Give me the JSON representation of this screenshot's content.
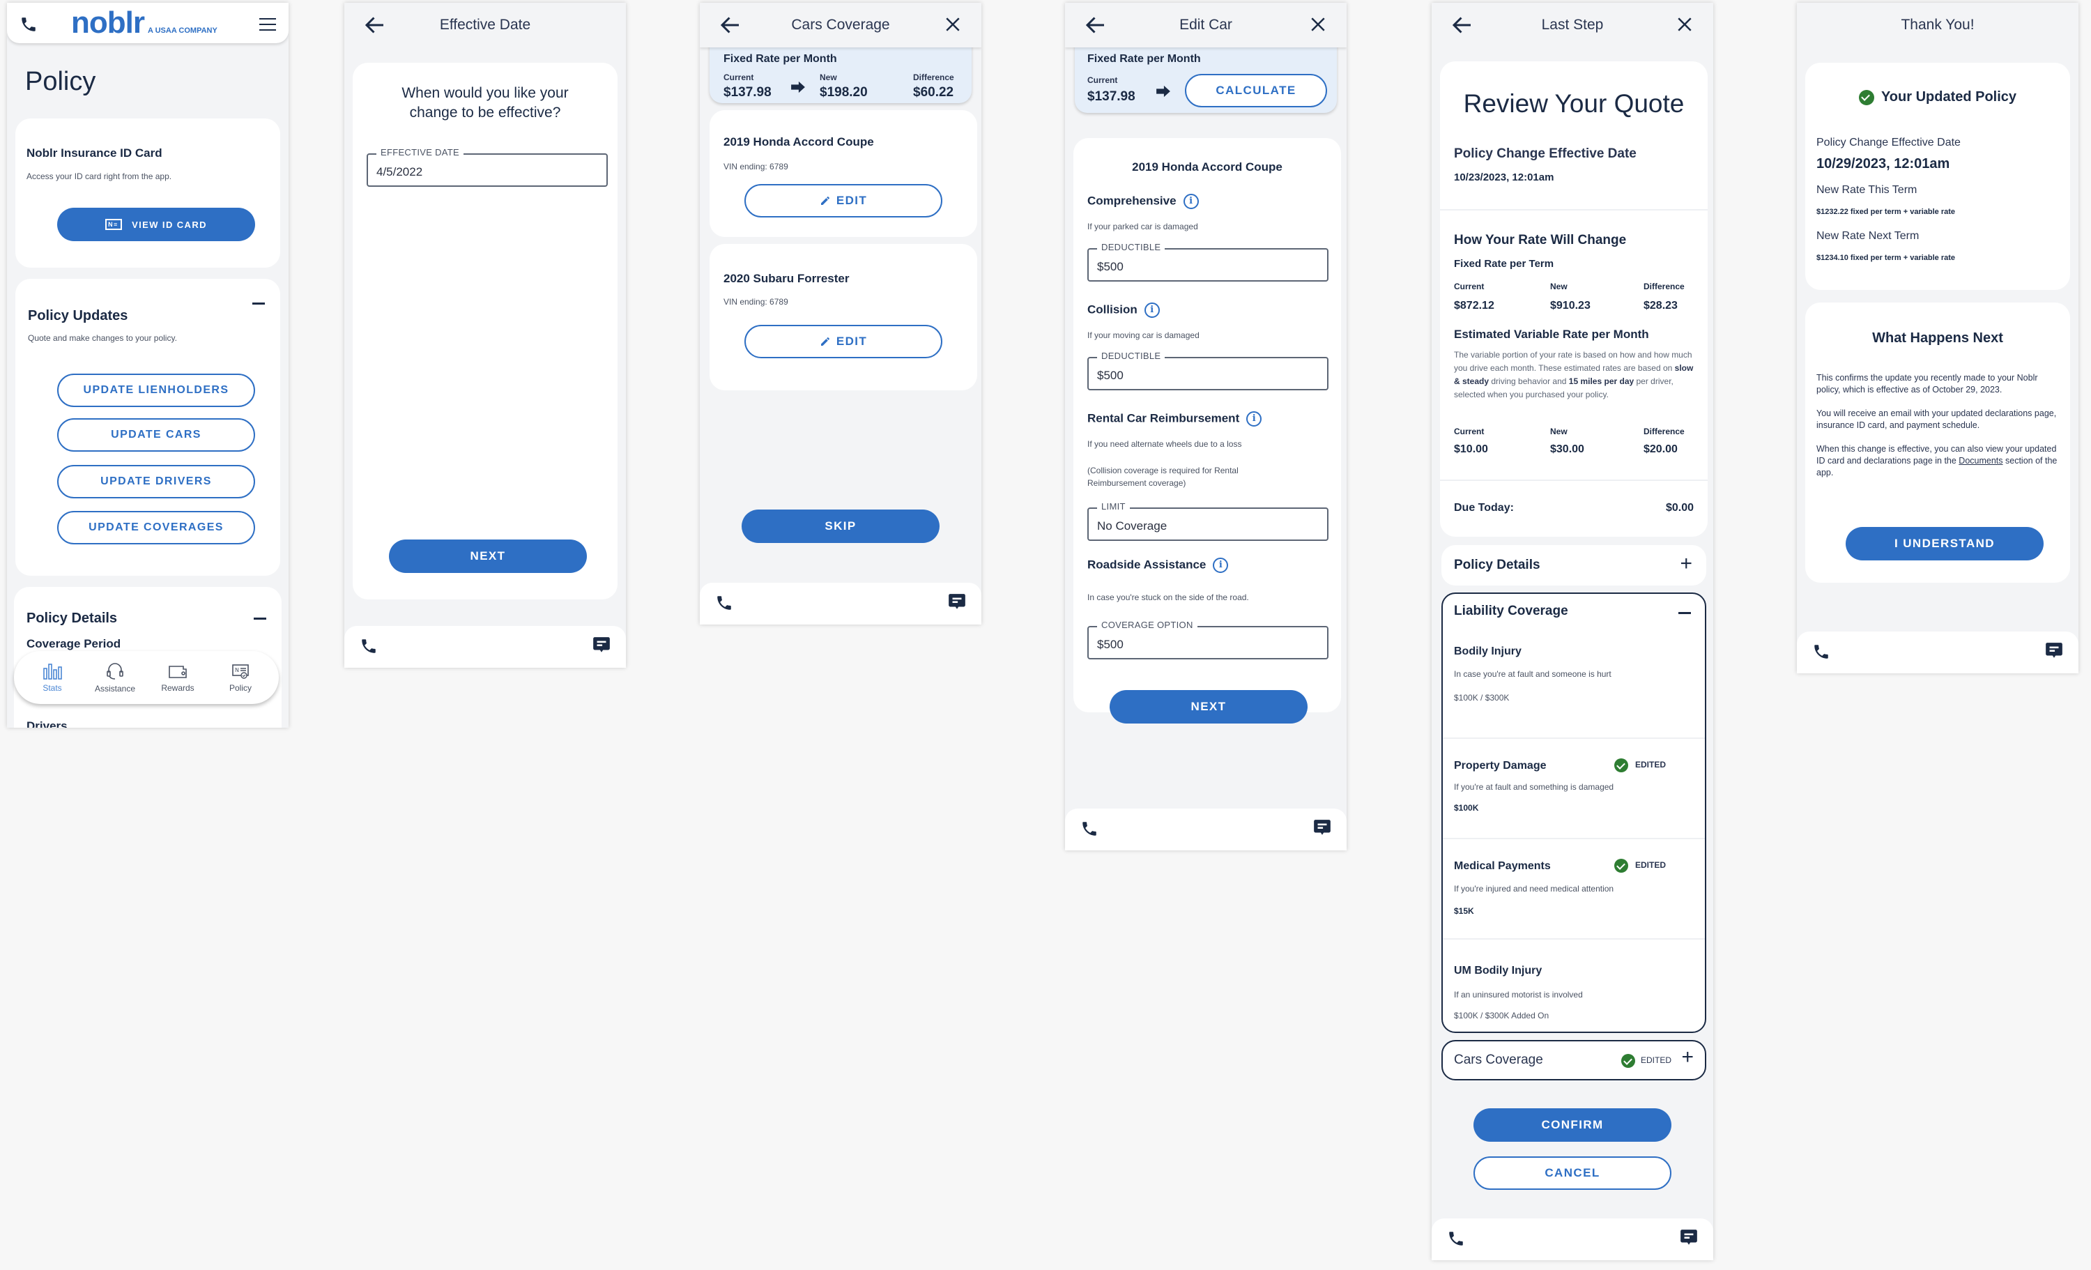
{
  "screen1": {
    "brand": "noblr",
    "brand_tagline": "A USAA COMPANY",
    "page_title": "Policy",
    "id_card": {
      "title": "Noblr Insurance ID Card",
      "subtitle": "Access your ID card right from the app.",
      "button": "VIEW ID CARD"
    },
    "policy_updates": {
      "title": "Policy Updates",
      "subtitle": "Quote and make changes to your policy.",
      "buttons": [
        "UPDATE LIENHOLDERS",
        "UPDATE CARS",
        "UPDATE DRIVERS",
        "UPDATE COVERAGES"
      ]
    },
    "policy_details": {
      "title": "Policy Details",
      "peek_1": "Coverage Period",
      "peek_2": "Drivers"
    },
    "nav": [
      {
        "label": "Stats",
        "icon": "stats-icon",
        "active": true
      },
      {
        "label": "Assistance",
        "icon": "headset-icon",
        "active": false
      },
      {
        "label": "Rewards",
        "icon": "wallet-icon",
        "active": false
      },
      {
        "label": "Policy",
        "icon": "policy-doc-icon",
        "active": false
      }
    ]
  },
  "screen2": {
    "header": "Effective Date",
    "question": "When would you like your change to be effective?",
    "field_label": "EFFECTIVE DATE",
    "field_value": "4/5/2022",
    "next": "NEXT"
  },
  "screen3": {
    "header": "Cars Coverage",
    "banner": {
      "title": "Fixed Rate per Month",
      "current_label": "Current",
      "current": "$137.98",
      "new_label": "New",
      "new": "$198.20",
      "diff_label": "Difference",
      "diff": "$60.22"
    },
    "cars": [
      {
        "name": "2019 Honda Accord Coupe",
        "vin": "VIN ending: 6789",
        "edit": "EDIT"
      },
      {
        "name": "2020 Subaru Forrester",
        "vin": "VIN ending: 6789",
        "edit": "EDIT"
      }
    ],
    "skip": "SKIP"
  },
  "screen4": {
    "header": "Edit Car",
    "banner": {
      "title": "Fixed Rate per Month",
      "current_label": "Current",
      "current": "$137.98",
      "calculate": "CALCULATE"
    },
    "car_name": "2019 Honda Accord Coupe",
    "sections": [
      {
        "title": "Comprehensive",
        "desc": "If your parked car is damaged",
        "field_label": "DEDUCTIBLE",
        "field_value": "$500"
      },
      {
        "title": "Collision",
        "desc": "If your moving car is damaged",
        "field_label": "DEDUCTIBLE",
        "field_value": "$500"
      },
      {
        "title": "Rental Car Reimbursement",
        "desc": "If you need alternate wheels due to a loss",
        "note": "(Collision coverage is required for Rental Reimbursement coverage)",
        "field_label": "LIMIT",
        "field_value": "No Coverage"
      },
      {
        "title": "Roadside Assistance",
        "desc": "In case you're stuck on the side of the road.",
        "field_label": "COVERAGE OPTION",
        "field_value": "$500"
      }
    ],
    "next": "NEXT"
  },
  "screen5": {
    "header": "Last Step",
    "title": "Review Your Quote",
    "effective_label": "Policy Change Effective Date",
    "effective_value": "10/23/2023, 12:01am",
    "rate_change_title": "How Your Rate Will Change",
    "fixed_title": "Fixed Rate per Term",
    "fixed": {
      "current_label": "Current",
      "current": "$872.12",
      "new_label": "New",
      "new": "$910.23",
      "diff_label": "Difference",
      "diff": "$28.23"
    },
    "variable_title": "Estimated Variable Rate per Month",
    "variable_desc_1": "The variable portion of your rate is based on how and how much you drive each month. These estimated rates are based on ",
    "variable_desc_bold_1": "slow & steady",
    "variable_desc_2": " driving behavior and ",
    "variable_desc_bold_2": "15 miles per day",
    "variable_desc_3": " per driver, selected when you purchased your policy.",
    "variable": {
      "current_label": "Current",
      "current": "$10.00",
      "new_label": "New",
      "new": "$30.00",
      "diff_label": "Difference",
      "diff": "$20.00"
    },
    "due_label": "Due Today:",
    "due_value": "$0.00",
    "policy_details": "Policy Details",
    "liability": {
      "title": "Liability Coverage",
      "items": [
        {
          "title": "Bodily Injury",
          "desc": "In case you're at fault and someone is hurt",
          "value": "$100K / $300K",
          "edited": false
        },
        {
          "title": "Property Damage",
          "desc": "If you're at fault and something is damaged",
          "value": "$100K",
          "edited": true
        },
        {
          "title": "Medical Payments",
          "desc": "If you're injured and need medical attention",
          "value": "$15K",
          "edited": true
        },
        {
          "title": "UM Bodily Injury",
          "desc": "If an uninsured motorist is involved",
          "value": "$100K / $300K Added On",
          "edited": false
        }
      ]
    },
    "edited_label": "EDITED",
    "cars_coverage": "Cars Coverage",
    "confirm": "CONFIRM",
    "cancel": "CANCEL"
  },
  "screen6": {
    "header": "Thank You!",
    "updated_title": "Your Updated Policy",
    "effective_label": "Policy Change Effective Date",
    "effective_value": "10/29/2023, 12:01am",
    "this_term_label": "New Rate This Term",
    "this_term_value": "$1232.22 fixed per term + variable rate",
    "next_term_label": "New Rate Next Term",
    "next_term_value": "$1234.10 fixed per term + variable rate",
    "next_title": "What Happens Next",
    "para1": "This confirms the update you recently made to your Noblr policy, which is effective as of October 29, 2023.",
    "para2": "You will receive an email with your updated declarations page, insurance ID card, and payment schedule.",
    "para3_a": "When this change is effective, you can also view your updated ID card and declarations page in the ",
    "para3_link": "Documents",
    "para3_b": " section of the app.",
    "understand": "I UNDERSTAND"
  },
  "colors": {
    "primary": "#2e6fc4",
    "text": "#1b2a44",
    "banner": "#e5eef9",
    "success": "#2e7d32",
    "screen_bg": "#f3f4f6"
  }
}
